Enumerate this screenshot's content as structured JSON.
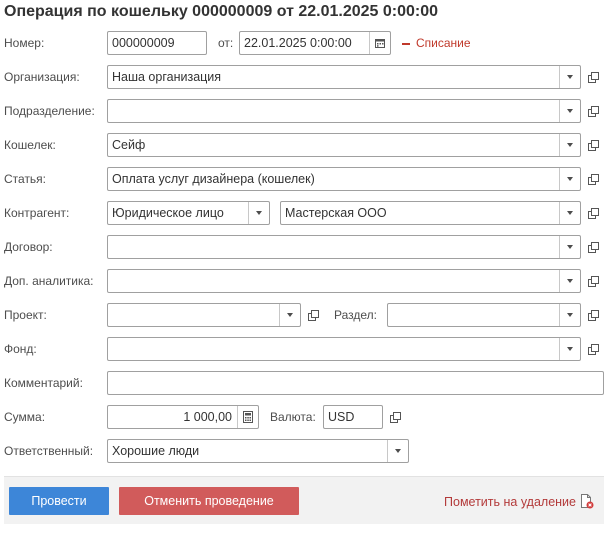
{
  "title": "Операция по кошельку 000000009 от 22.01.2025 0:00:00",
  "number": {
    "label": "Номер:",
    "value": "000000009"
  },
  "date": {
    "label": "от:",
    "value": "22.01.2025  0:00:00"
  },
  "operation_type": "Списание",
  "organization": {
    "label": "Организация:",
    "value": "Наша организация"
  },
  "department": {
    "label": "Подразделение:",
    "value": ""
  },
  "wallet": {
    "label": "Кошелек:",
    "value": "Сейф"
  },
  "article": {
    "label": "Статья:",
    "value": "Оплата услуг дизайнера (кошелек)"
  },
  "counterparty": {
    "label": "Контрагент:",
    "type_value": "Юридическое лицо",
    "value": "Мастерская ООО"
  },
  "contract": {
    "label": "Договор:",
    "value": ""
  },
  "analytics": {
    "label": "Доп. аналитика:",
    "value": ""
  },
  "project": {
    "label": "Проект:",
    "value": ""
  },
  "section": {
    "label": "Раздел:",
    "value": ""
  },
  "fund": {
    "label": "Фонд:",
    "value": ""
  },
  "comment": {
    "label": "Комментарий:",
    "value": ""
  },
  "amount": {
    "label": "Сумма:",
    "value": "1 000,00"
  },
  "currency": {
    "label": "Валюта:",
    "value": "USD"
  },
  "responsible": {
    "label": "Ответственный:",
    "value": "Хорошие люди"
  },
  "buttons": {
    "post": "Провести",
    "unpost": "Отменить проведение",
    "mark_delete": "Пометить на удаление"
  },
  "colors": {
    "post_button": "#3d86d8",
    "unpost_button": "#d15b5b",
    "operation_type": "#c0392b",
    "mark_delete": "#b33a3a"
  },
  "icons": [
    "calendar-icon",
    "dropdown-arrow-icon",
    "open-form-icon",
    "calculator-icon",
    "delete-document-icon"
  ]
}
